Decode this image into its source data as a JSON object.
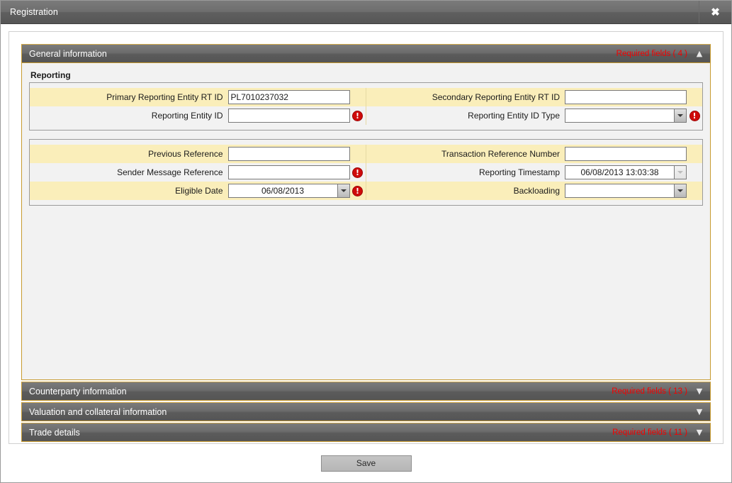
{
  "window": {
    "title": "Registration",
    "close_icon": "close-icon",
    "close_label": "✖"
  },
  "sections": [
    {
      "id": "general-information",
      "title": "General information",
      "required_text": "Required fields ( 4 )",
      "expanded": true,
      "chevron": "▲",
      "chevron_name": "chevron-up-icon",
      "group_label": "Reporting"
    },
    {
      "id": "counterparty-information",
      "title": "Counterparty information",
      "required_text": "Required fields ( 13 )",
      "expanded": false,
      "chevron": "▼",
      "chevron_name": "chevron-down-icon"
    },
    {
      "id": "valuation-and-collateral-information",
      "title": "Valuation and collateral information",
      "required_text": "",
      "expanded": false,
      "chevron": "▼",
      "chevron_name": "chevron-down-icon"
    },
    {
      "id": "trade-details",
      "title": "Trade details",
      "required_text": "Required fields ( 11 )",
      "expanded": false,
      "chevron": "▼",
      "chevron_name": "chevron-down-icon"
    }
  ],
  "fields": {
    "primary_reporting_entity_rt_id": {
      "label": "Primary Reporting Entity RT ID",
      "value": "PL7010237032",
      "placeholder": "",
      "type": "text",
      "error": false
    },
    "secondary_reporting_entity_rt_id": {
      "label": "Secondary Reporting Entity RT ID",
      "value": "",
      "placeholder": "",
      "type": "text",
      "error": false
    },
    "reporting_entity_id": {
      "label": "Reporting Entity ID",
      "value": "",
      "placeholder": "",
      "type": "text",
      "error": true
    },
    "reporting_entity_id_type": {
      "label": "Reporting Entity ID Type",
      "value": "",
      "type": "combo",
      "enabled": true,
      "error": true
    },
    "previous_reference": {
      "label": "Previous Reference",
      "value": "",
      "placeholder": "",
      "type": "text",
      "error": false
    },
    "transaction_reference_number": {
      "label": "Transaction Reference Number",
      "value": "",
      "placeholder": "",
      "type": "text",
      "error": false
    },
    "sender_message_reference": {
      "label": "Sender Message Reference",
      "value": "",
      "placeholder": "",
      "type": "text",
      "error": true
    },
    "reporting_timestamp": {
      "label": "Reporting Timestamp",
      "value": "06/08/2013 13:03:38",
      "type": "combo",
      "enabled": false,
      "error": false
    },
    "eligible_date": {
      "label": "Eligible Date",
      "value": "06/08/2013",
      "type": "combo",
      "enabled": true,
      "error": true
    },
    "backloading": {
      "label": "Backloading",
      "value": "",
      "type": "combo",
      "enabled": true,
      "error": false
    }
  },
  "error_icon_glyph": "!",
  "footer": {
    "save_label": "Save"
  },
  "colors": {
    "required_red": "#f40000",
    "error_red": "#cf0a0a",
    "row_highlight": "#faeeba",
    "panel_border": "#c79a2e",
    "header_gray": "#6c6c6c"
  }
}
